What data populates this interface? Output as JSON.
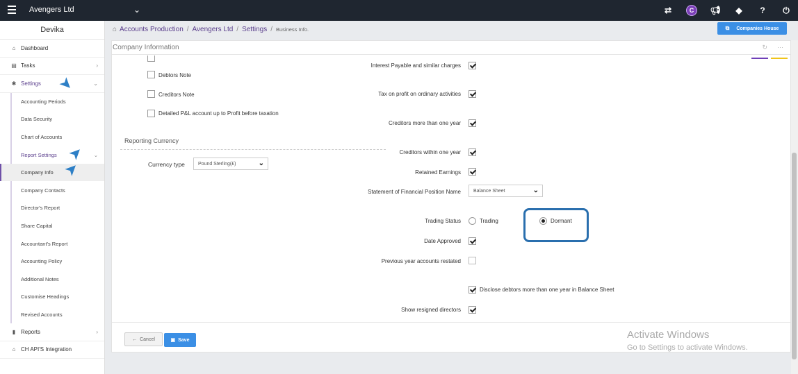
{
  "topbar": {
    "org_name": "Avengers Ltd",
    "icons": [
      "swap-icon",
      "c-app-icon",
      "megaphone-icon",
      "tag-icon",
      "help-icon",
      "power-icon"
    ],
    "c_letter": "C"
  },
  "sidebar": {
    "user": "Devika",
    "items": [
      {
        "label": "Dashboard",
        "icon": "home-icon"
      },
      {
        "label": "Tasks",
        "icon": "tasks-icon"
      },
      {
        "label": "Settings",
        "icon": "gear-icon"
      }
    ],
    "settings_sub": [
      "Accounting Periods",
      "Data Security",
      "Chart of Accounts",
      "Report Settings",
      "Company Info",
      "Company Contacts",
      "Director's Report",
      "Share Capital",
      "Accountant's Report",
      "Accounting Policy",
      "Additional Notes",
      "Customise Headings",
      "Revised Accounts"
    ],
    "bottom_items": [
      {
        "label": "Reports",
        "icon": "file-icon"
      },
      {
        "label": "CH API'S Integration",
        "icon": "home-icon"
      }
    ]
  },
  "breadcrumb": {
    "items": [
      "Accounts Production",
      "Avengers Ltd",
      "Settings"
    ],
    "current": "Business Info."
  },
  "companies_house_button": "Companies House",
  "panel": {
    "title": "Company Information",
    "left_checks": [
      {
        "label": "Debtors Note",
        "checked": false
      },
      {
        "label": "Creditors Note",
        "checked": false
      },
      {
        "label": "Detailed P&L account up to Profit before taxation",
        "checked": false
      }
    ],
    "reporting_currency_title": "Reporting Currency",
    "currency_type_label": "Currency type",
    "currency_value": "Pound Sterling(£)",
    "right_checks": [
      {
        "label": "Interest Payable and similar charges",
        "checked": true
      },
      {
        "label": "Tax on profit on ordinary activities",
        "checked": true
      },
      {
        "label": "Creditors more than one year",
        "checked": true
      },
      {
        "label": "Creditors within one year",
        "checked": true
      },
      {
        "label": "Retained Earnings",
        "checked": true
      }
    ],
    "sofp_label": "Statement of Financial Position Name",
    "sofp_value": "Balance Sheet",
    "trading_status_label": "Trading Status",
    "trading_option": "Trading",
    "dormant_option": "Dormant",
    "trading_selected": "Dormant",
    "date_approved_label": "Date Approved",
    "date_approved_checked": true,
    "prev_year_label": "Previous year accounts restated",
    "prev_year_checked": false,
    "disclose_label": "Disclose debtors more than one year in Balance Sheet",
    "disclose_checked": true,
    "show_resigned_label": "Show resigned directors",
    "show_resigned_checked": true
  },
  "footer": {
    "cancel": "Cancel",
    "save": "Save"
  },
  "watermark": {
    "line1": "Activate Windows",
    "line2": "Go to Settings to activate Windows."
  },
  "colors": {
    "topbar": "#1f2630",
    "accent_purple": "#5a3e8c",
    "primary_blue": "#3b8fe5",
    "highlight_blue": "#2a6fae"
  }
}
